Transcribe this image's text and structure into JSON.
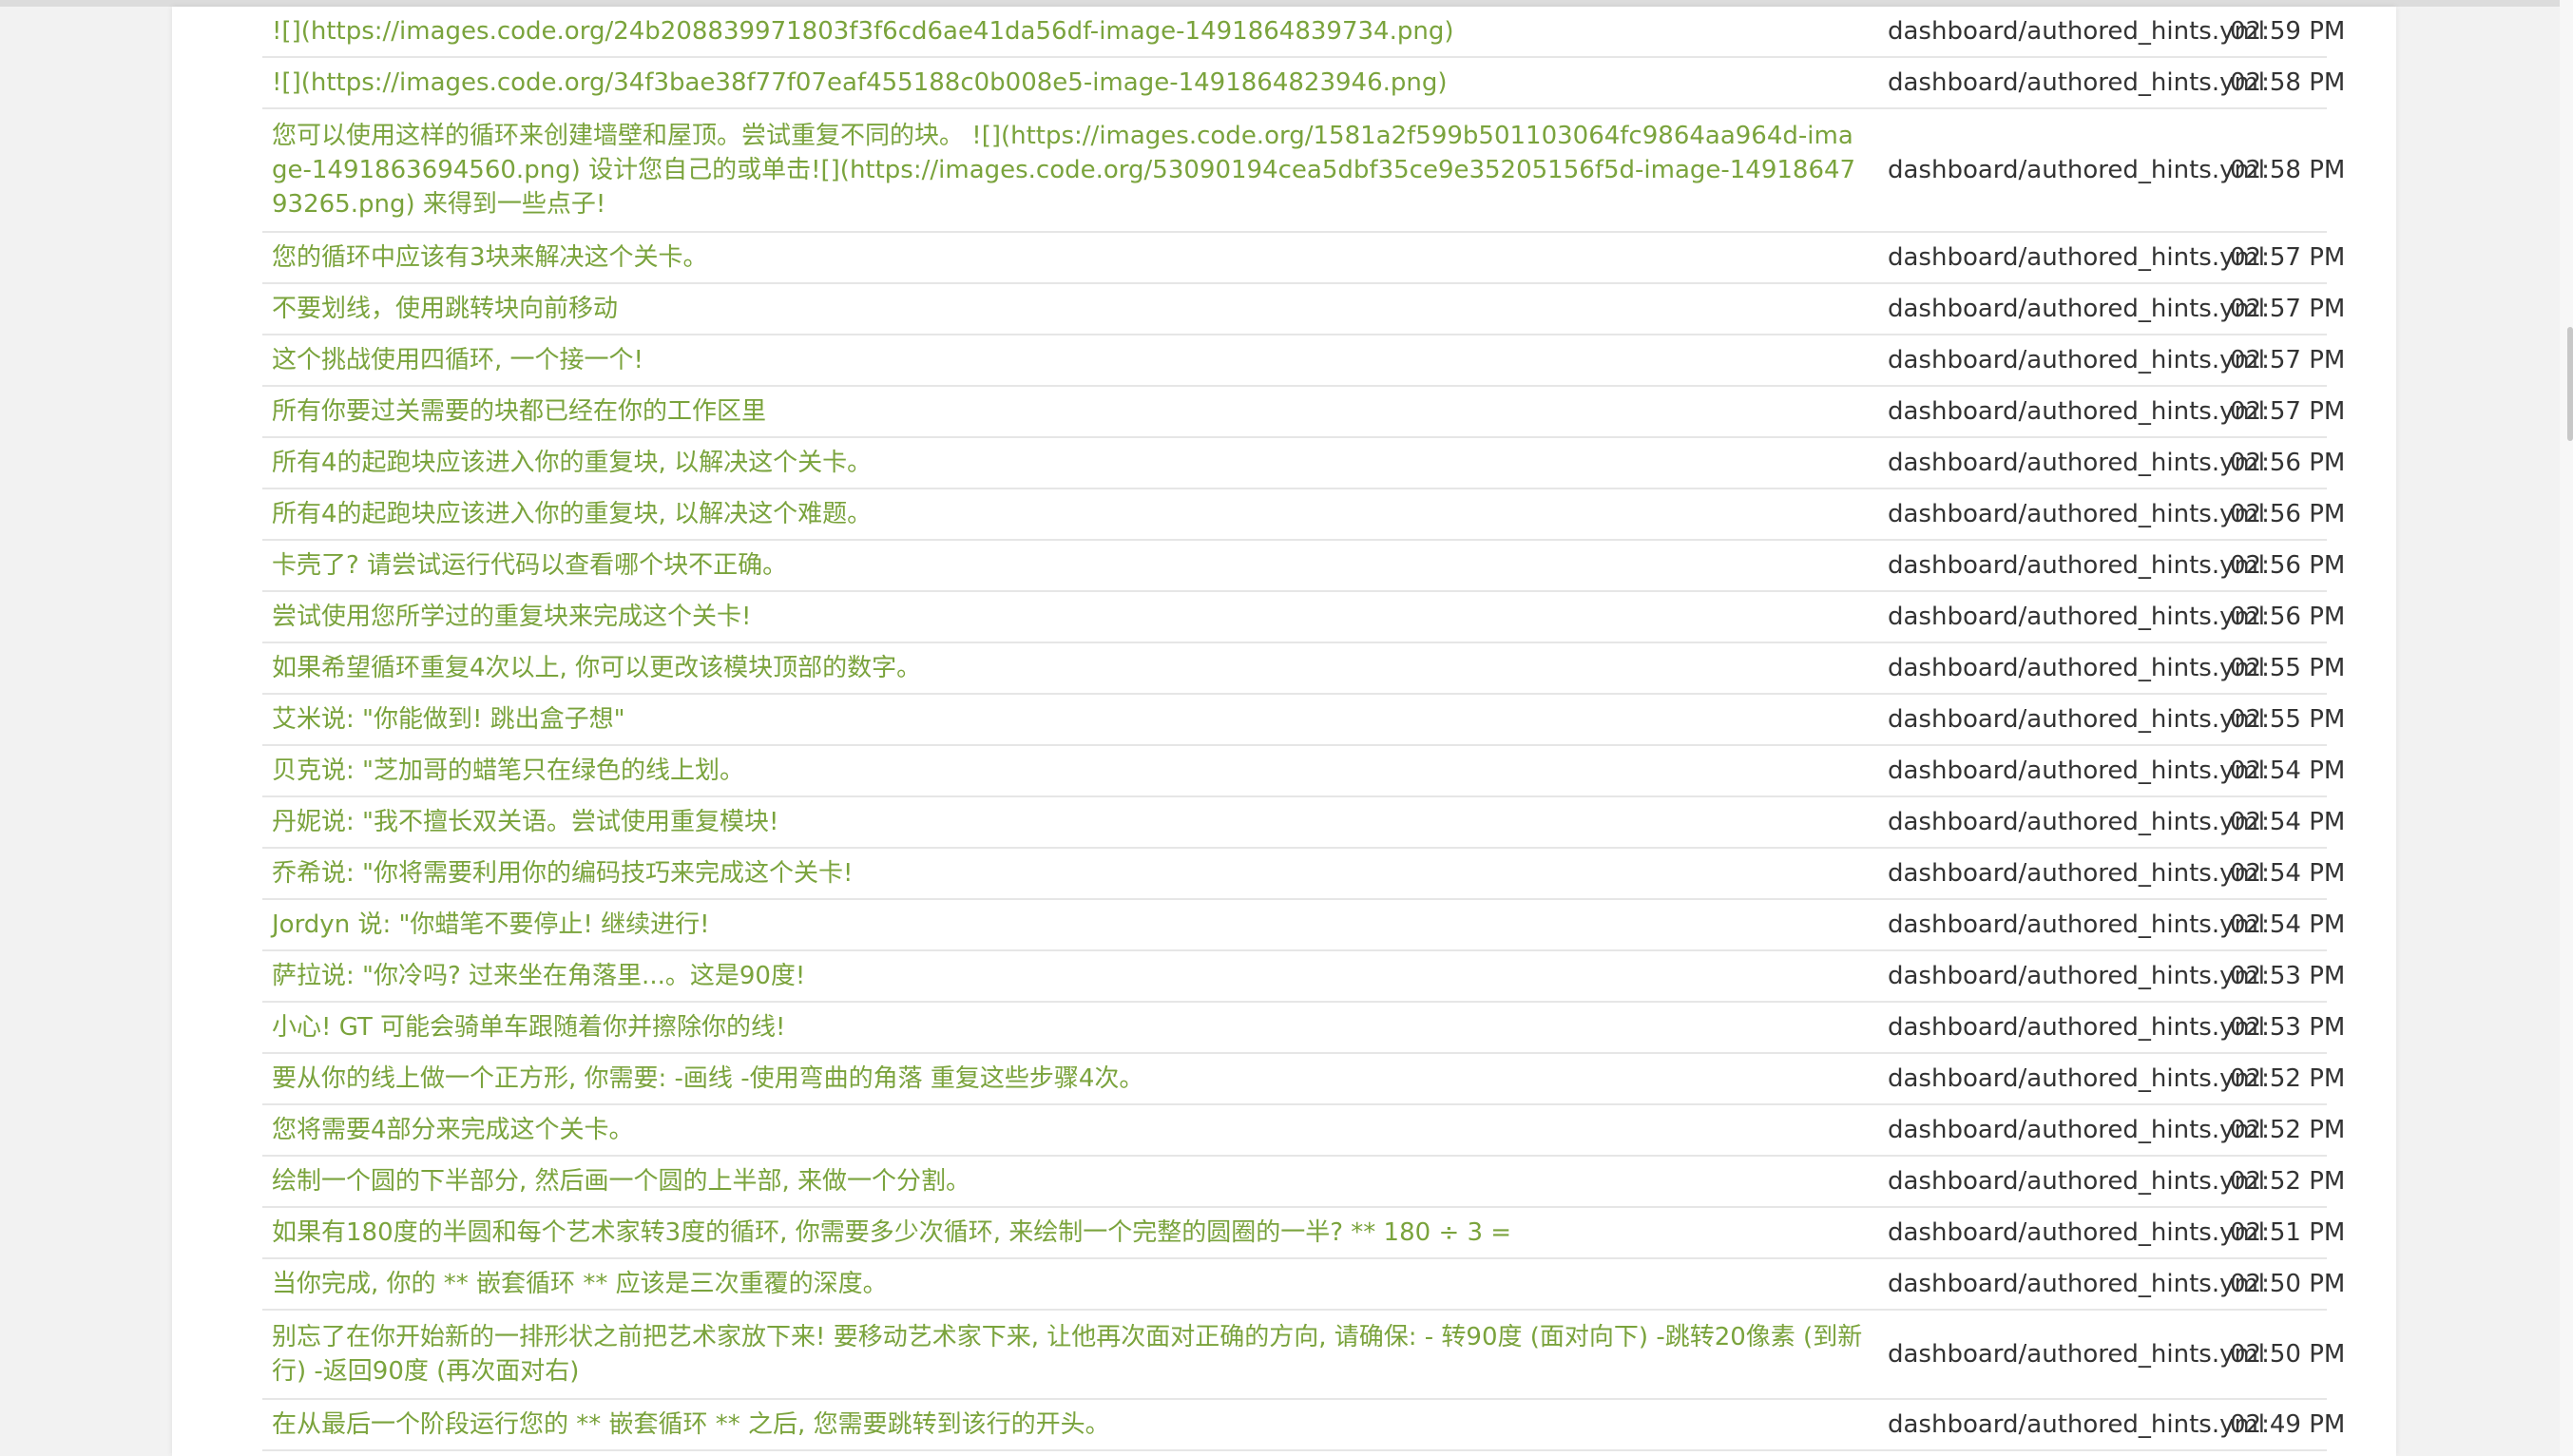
{
  "colors": {
    "hint_text": "#7aa33c",
    "meta_text": "#333333",
    "row_border": "#e6e6e6",
    "page_bg": "#f2f2f2"
  },
  "rows": [
    {
      "text": "![](https://images.code.org/24b208839971803f3f6cd6ae41da56df-image-1491864839734.png)",
      "file": "dashboard/authored_hints.yml",
      "time": "02:59 PM"
    },
    {
      "text": "![](https://images.code.org/34f3bae38f77f07eaf455188c0b008e5-image-1491864823946.png)",
      "file": "dashboard/authored_hints.yml",
      "time": "02:58 PM"
    },
    {
      "text": "您可以使用这样的循环来创建墙壁和屋顶。尝试重复不同的块。 ![](https://images.code.org/1581a2f599b501103064fc9864aa964d-image-1491863694560.png) 设计您自己的或单击![](https://images.code.org/53090194cea5dbf35ce9e35205156f5d-image-1491864793265.png) 来得到一些点子!",
      "file": "dashboard/authored_hints.yml",
      "time": "02:58 PM"
    },
    {
      "text": "您的循环中应该有3块来解决这个关卡。",
      "file": "dashboard/authored_hints.yml",
      "time": "02:57 PM"
    },
    {
      "text": "不要划线，使用跳转块向前移动",
      "file": "dashboard/authored_hints.yml",
      "time": "02:57 PM"
    },
    {
      "text": "这个挑战使用四循环, 一个接一个!",
      "file": "dashboard/authored_hints.yml",
      "time": "02:57 PM"
    },
    {
      "text": "所有你要过关需要的块都已经在你的工作区里",
      "file": "dashboard/authored_hints.yml",
      "time": "02:57 PM"
    },
    {
      "text": "所有4的起跑块应该进入你的重复块, 以解决这个关卡。",
      "file": "dashboard/authored_hints.yml",
      "time": "02:56 PM"
    },
    {
      "text": "所有4的起跑块应该进入你的重复块, 以解决这个难题。",
      "file": "dashboard/authored_hints.yml",
      "time": "02:56 PM"
    },
    {
      "text": "卡壳了? 请尝试运行代码以查看哪个块不正确。",
      "file": "dashboard/authored_hints.yml",
      "time": "02:56 PM"
    },
    {
      "text": "尝试使用您所学过的重复块来完成这个关卡!",
      "file": "dashboard/authored_hints.yml",
      "time": "02:56 PM"
    },
    {
      "text": "如果希望循环重复4次以上, 你可以更改该模块顶部的数字。",
      "file": "dashboard/authored_hints.yml",
      "time": "02:55 PM"
    },
    {
      "text": "艾米说: \"你能做到! 跳出盒子想\"",
      "file": "dashboard/authored_hints.yml",
      "time": "02:55 PM"
    },
    {
      "text": "贝克说: \"芝加哥的蜡笔只在绿色的线上划。",
      "file": "dashboard/authored_hints.yml",
      "time": "02:54 PM"
    },
    {
      "text": "丹妮说: \"我不擅长双关语。尝试使用重复模块!",
      "file": "dashboard/authored_hints.yml",
      "time": "02:54 PM"
    },
    {
      "text": "乔希说: \"你将需要利用你的编码技巧来完成这个关卡!",
      "file": "dashboard/authored_hints.yml",
      "time": "02:54 PM"
    },
    {
      "text": "Jordyn 说: \"你蜡笔不要停止! 继续进行!",
      "file": "dashboard/authored_hints.yml",
      "time": "02:54 PM"
    },
    {
      "text": "萨拉说: \"你冷吗? 过来坐在角落里...。这是90度!",
      "file": "dashboard/authored_hints.yml",
      "time": "02:53 PM"
    },
    {
      "text": "小心! GT 可能会骑单车跟随着你并擦除你的线!",
      "file": "dashboard/authored_hints.yml",
      "time": "02:53 PM"
    },
    {
      "text": "要从你的线上做一个正方形, 你需要: -画线 -使用弯曲的角落 重复这些步骤4次。",
      "file": "dashboard/authored_hints.yml",
      "time": "02:52 PM"
    },
    {
      "text": "您将需要4部分来完成这个关卡。",
      "file": "dashboard/authored_hints.yml",
      "time": "02:52 PM"
    },
    {
      "text": "绘制一个圆的下半部分, 然后画一个圆的上半部, 来做一个分割。",
      "file": "dashboard/authored_hints.yml",
      "time": "02:52 PM"
    },
    {
      "text": "如果有180度的半圆和每个艺术家转3度的循环, 你需要多少次循环, 来绘制一个完整的圆圈的一半?  ** 180 ÷ 3 =",
      "file": "dashboard/authored_hints.yml",
      "time": "02:51 PM"
    },
    {
      "text": "当你完成, 你的 ** 嵌套循环 ** 应该是三次重覆的深度。",
      "file": "dashboard/authored_hints.yml",
      "time": "02:50 PM"
    },
    {
      "text": "别忘了在你开始新的一排形状之前把艺术家放下来! 要移动艺术家下来, 让他再次面对正确的方向, 请确保: - 转90度 (面对向下) -跳转20像素 (到新行) -返回90度 (再次面对右)",
      "file": "dashboard/authored_hints.yml",
      "time": "02:50 PM"
    },
    {
      "text": "在从最后一个阶段运行您的 ** 嵌套循环 ** 之后, 您需要跳转到该行的开头。",
      "file": "dashboard/authored_hints.yml",
      "time": "02:49 PM"
    }
  ]
}
